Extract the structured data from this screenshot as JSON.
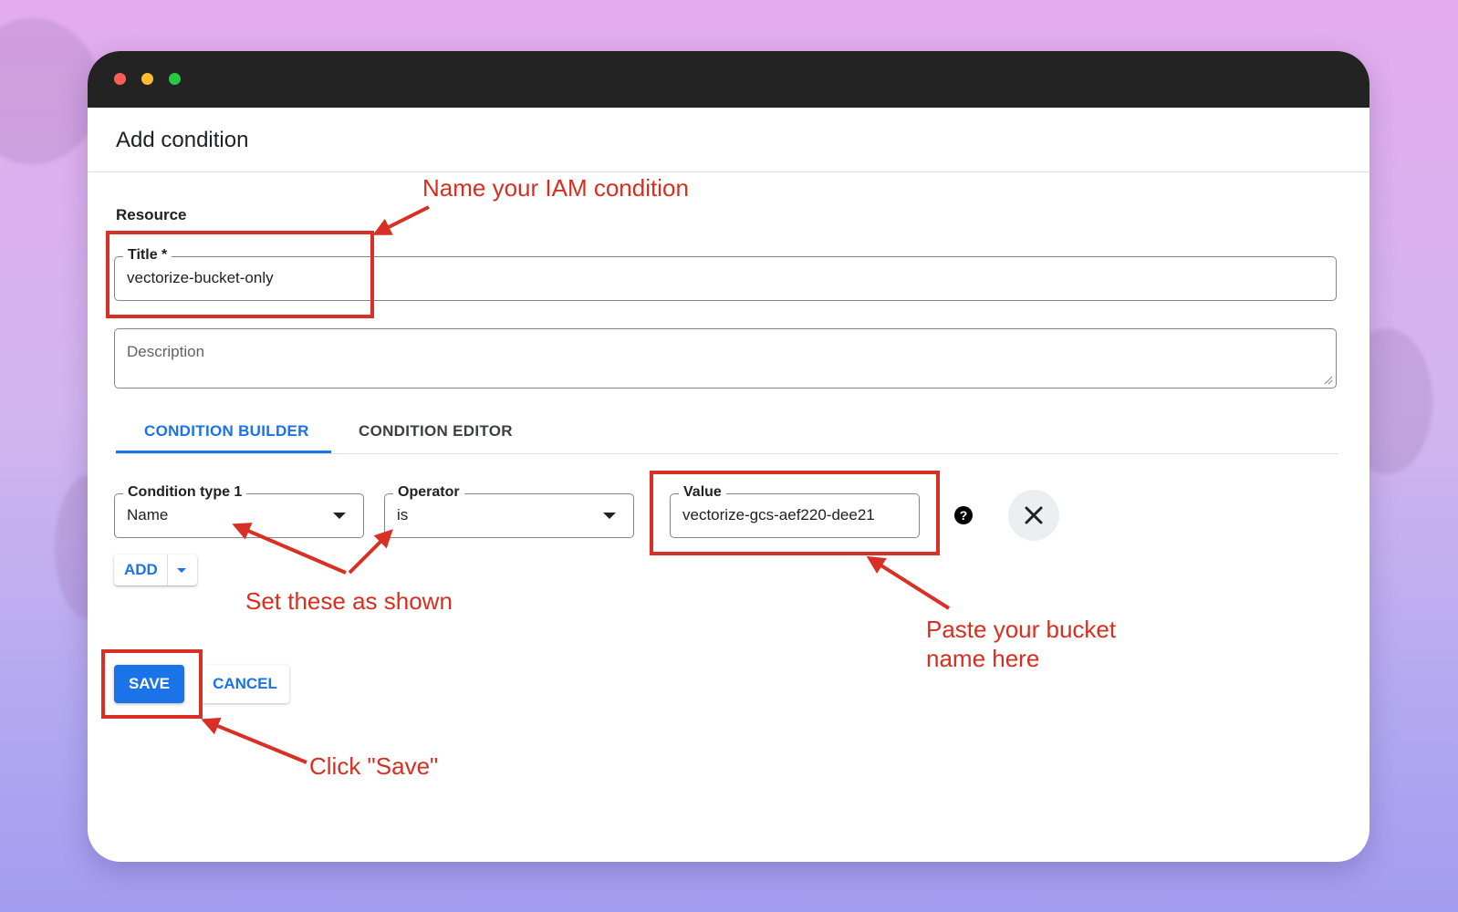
{
  "dialog": {
    "title": "Add condition",
    "section_label": "Resource"
  },
  "form": {
    "title_field": {
      "label": "Title *",
      "value": "vectorize-bucket-only"
    },
    "description_field": {
      "placeholder": "Description"
    }
  },
  "tabs": [
    {
      "label": "CONDITION BUILDER",
      "active": true
    },
    {
      "label": "CONDITION EDITOR",
      "active": false
    }
  ],
  "condition_row": {
    "condition_type": {
      "label": "Condition type 1",
      "value": "Name"
    },
    "operator": {
      "label": "Operator",
      "value": "is"
    },
    "value": {
      "label": "Value",
      "value": "vectorize-gcs-aef220-dee21"
    },
    "help_icon": "question-mark-circle-icon",
    "remove_icon": "close-x-icon"
  },
  "add_button": {
    "label": "ADD",
    "icon": "caret-down-icon"
  },
  "actions": {
    "save_label": "SAVE",
    "cancel_label": "CANCEL"
  },
  "annotations": {
    "name_condition": "Name your IAM condition",
    "set_as_shown": "Set these as shown",
    "paste_bucket_line1": "Paste your bucket",
    "paste_bucket_line2": "name here",
    "click_save": "Click \"Save\""
  },
  "colors": {
    "accent_blue": "#1a73e8",
    "annotation_red": "#d93025",
    "titlebar": "#232323",
    "traffic_red": "#ff5f57",
    "traffic_yellow": "#febc2e",
    "traffic_green": "#28c840"
  }
}
